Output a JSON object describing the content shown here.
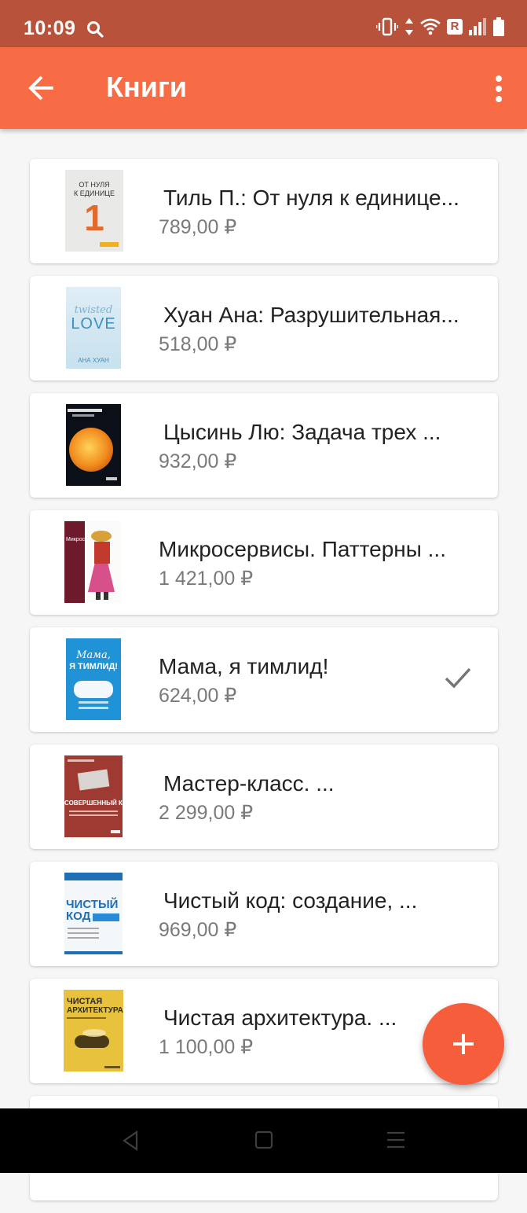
{
  "status_bar": {
    "time": "10:09",
    "network_badge": "R"
  },
  "app_bar": {
    "title": "Книги"
  },
  "books": [
    {
      "title": "Тиль П.: От нуля к единице...",
      "price": "789,00 ₽",
      "selected": false
    },
    {
      "title": "Хуан Ана: Разрушительная...",
      "price": "518,00 ₽",
      "selected": false
    },
    {
      "title": "Цысинь Лю: Задача трех ...",
      "price": "932,00 ₽",
      "selected": false
    },
    {
      "title": "Микросервисы. Паттерны ...",
      "price": "1 421,00 ₽",
      "selected": false
    },
    {
      "title": "Мама, я тимлид!",
      "price": "624,00 ₽",
      "selected": true
    },
    {
      "title": "Мастер-класс. ...",
      "price": "2 299,00 ₽",
      "selected": false
    },
    {
      "title": "Чистый код: создание, ...",
      "price": "969,00 ₽",
      "selected": false
    },
    {
      "title": "Чистая архитектура. ...",
      "price": "1 100,00 ₽",
      "selected": false
    }
  ],
  "covers": {
    "0": {
      "line1": "ОТ НУЛЯ",
      "line2": "К ЕДИНИЦЕ",
      "digit": "1"
    },
    "1": {
      "script": "twisted",
      "word": "LOVE",
      "author": "АНА ХУАН"
    },
    "3": {
      "word": "Микросервисы"
    },
    "4": {
      "line1": "Мама,",
      "line2": "Я ТИМЛИД!"
    },
    "5": {
      "word": "СОВЕРШЕННЫЙ КОД"
    },
    "6": {
      "line1": "ЧИСТЫЙ",
      "line2": "КОД"
    },
    "7": {
      "line1": "ЧИСТАЯ",
      "line2": "АРХИТЕКТУРА"
    }
  },
  "colors": {
    "status_bar": "#b9523a",
    "app_bar": "#f76b45",
    "fab": "#f55d3b",
    "background": "#f6f6f6"
  },
  "icons": [
    "search-icon",
    "vibrate-icon",
    "data-arrows-icon",
    "wifi-icon",
    "signal-icon",
    "battery-icon",
    "back-arrow-icon",
    "more-vert-icon",
    "check-icon",
    "add-icon",
    "nav-back-icon",
    "nav-home-icon",
    "nav-recents-icon"
  ]
}
